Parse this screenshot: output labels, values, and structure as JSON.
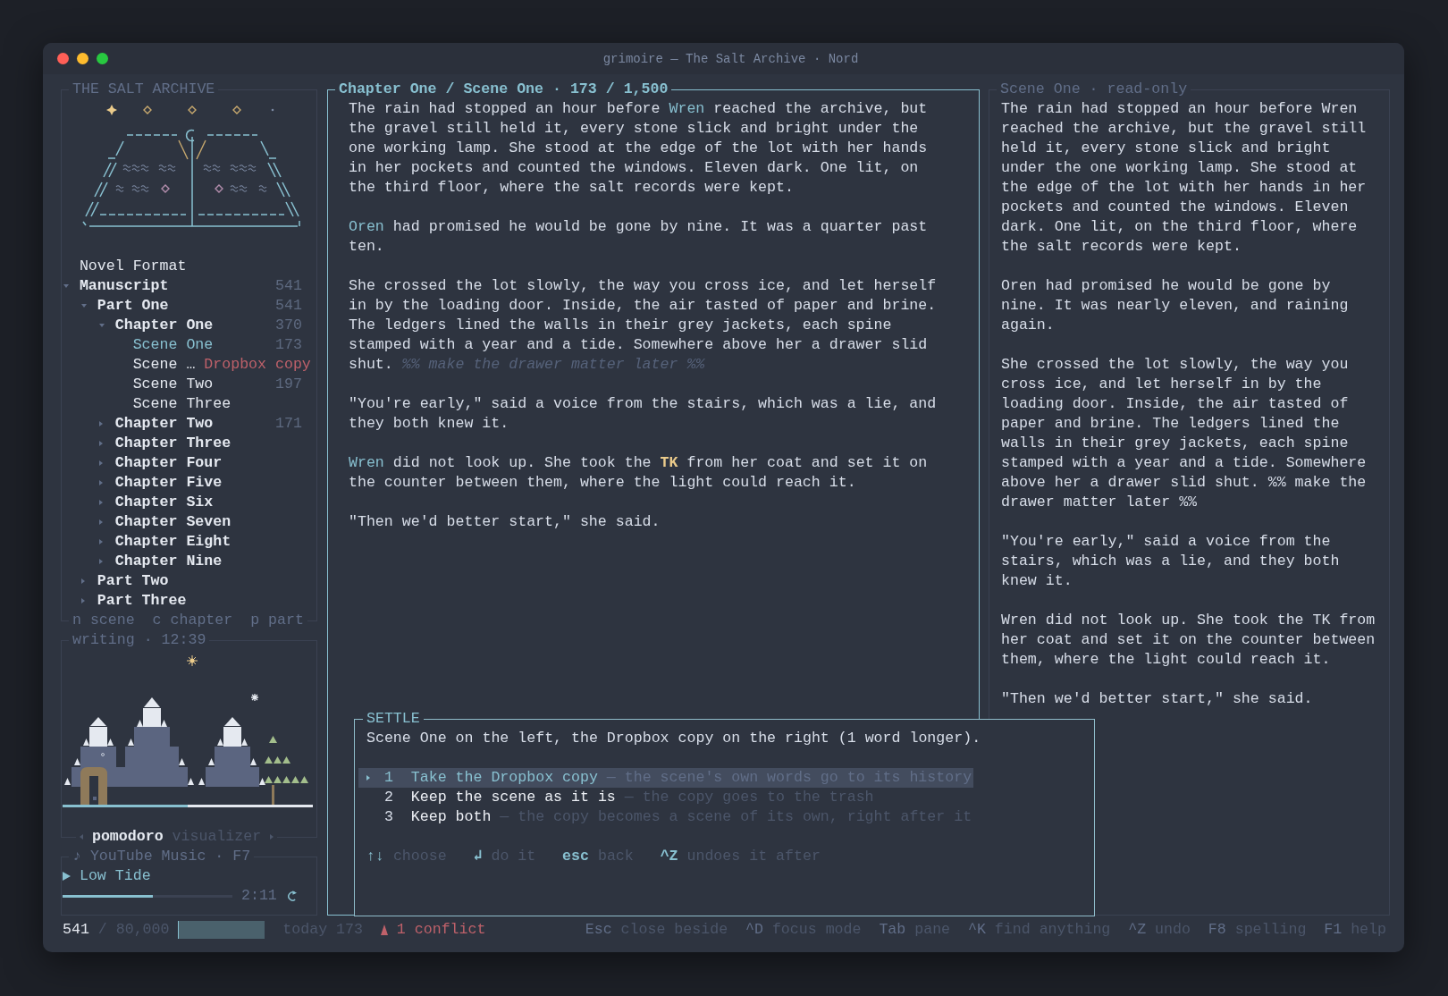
{
  "window": {
    "title": "grimoire — The Salt Archive · Nord"
  },
  "sidebar": {
    "title": "THE SALT ARCHIVE",
    "tree": [
      {
        "label": "Novel Format",
        "kind": "file",
        "selected": false
      },
      {
        "label": "Manuscript",
        "kind": "folder",
        "count": "541",
        "expanded": true,
        "selected": false,
        "children": [
          {
            "label": "Part One",
            "kind": "folder",
            "count": "541",
            "expanded": true,
            "selected": false,
            "children": [
              {
                "label": "Chapter One",
                "kind": "folder",
                "count": "370",
                "expanded": true,
                "selected": false,
                "children": [
                  {
                    "label": "Scene One",
                    "kind": "file",
                    "count": "173",
                    "selected": true
                  },
                  {
                    "label": "Scene …",
                    "kind": "file",
                    "tag": "Dropbox copy",
                    "selected": false
                  },
                  {
                    "label": "Scene Two",
                    "kind": "file",
                    "count": "197",
                    "selected": false
                  },
                  {
                    "label": "Scene Three",
                    "kind": "file",
                    "selected": false
                  }
                ]
              },
              {
                "label": "Chapter Two",
                "kind": "folder",
                "count": "171",
                "expanded": false,
                "selected": false
              },
              {
                "label": "Chapter Three",
                "kind": "folder",
                "expanded": false,
                "selected": false
              },
              {
                "label": "Chapter Four",
                "kind": "folder",
                "expanded": false,
                "selected": false
              },
              {
                "label": "Chapter Five",
                "kind": "folder",
                "expanded": false,
                "selected": false
              },
              {
                "label": "Chapter Six",
                "kind": "folder",
                "expanded": false,
                "selected": false
              },
              {
                "label": "Chapter Seven",
                "kind": "folder",
                "expanded": false,
                "selected": false
              },
              {
                "label": "Chapter Eight",
                "kind": "folder",
                "expanded": false,
                "selected": false
              },
              {
                "label": "Chapter Nine",
                "kind": "folder",
                "expanded": false,
                "selected": false
              }
            ]
          },
          {
            "label": "Part Two",
            "kind": "folder",
            "expanded": false,
            "selected": false
          },
          {
            "label": "Part Three",
            "kind": "folder",
            "expanded": false,
            "selected": false
          }
        ]
      }
    ],
    "hint": "n scene  c chapter  p part",
    "visualizer": {
      "title": "writing · 12:39",
      "level": 0.5,
      "tabs": [
        {
          "label": "pomodoro",
          "selected": true
        },
        {
          "label": "visualizer",
          "selected": false
        }
      ]
    },
    "music": {
      "title": "♪ YouTube Music · F7",
      "track": "Low Tide",
      "level": 0.53,
      "time": "2:11"
    }
  },
  "editor": {
    "title": "Chapter One / Scene One · 173 / 1,500",
    "paragraphs": [
      [
        {
          "kind": "text",
          "text": "The rain had stopped an hour before "
        },
        {
          "kind": "name",
          "text": "Wren"
        },
        {
          "kind": "text",
          "text": " reached the archive, but the gravel still held it, every stone slick and bright under the one working lamp. She stood at the edge of the lot with her hands in her pockets and counted the windows. Eleven dark. One lit, on the third floor, where the salt records were kept."
        }
      ],
      [
        {
          "kind": "name",
          "text": "Oren"
        },
        {
          "kind": "text",
          "text": " had promised he would be gone by nine. It was a quarter past ten."
        }
      ],
      [
        {
          "kind": "text",
          "text": "She crossed the lot slowly, the way you cross ice, and let herself in by the loading door. Inside, the air tasted of paper and brine. The ledgers lined the walls in their grey jackets, each spine stamped with a year and a tide. Somewhere above her a drawer slid shut. "
        },
        {
          "kind": "note",
          "text": "%% make the drawer matter later %%"
        }
      ],
      [
        {
          "kind": "text",
          "text": "\"You're early,\" said a voice from the stairs, which was a lie, and they both knew it."
        }
      ],
      [
        {
          "kind": "name",
          "text": "Wren"
        },
        {
          "kind": "text",
          "text": " did not look up. She took the "
        },
        {
          "kind": "mark",
          "text": "TK"
        },
        {
          "kind": "text",
          "text": " from her coat and set it on the counter between them, where the light could reach it."
        }
      ],
      [
        {
          "kind": "text",
          "text": "\"Then we'd better start,\" she said."
        }
      ]
    ]
  },
  "preview": {
    "title": "Scene One · read-only",
    "paragraphs": [
      "The rain had stopped an hour before Wren reached the archive, but the gravel still held it, every stone slick and bright under the one working lamp. She stood at the edge of the lot with her hands in her pockets and counted the windows. Eleven dark. One lit, on the third floor, where the salt records were kept.",
      "Oren had promised he would be gone by nine. It was nearly eleven, and raining again.",
      "She crossed the lot slowly, the way you cross ice, and let herself in by the loading door. Inside, the air tasted of paper and brine. The ledgers lined the walls in their grey jackets, each spine stamped with a year and a tide. Somewhere above her a drawer slid shut. %% make the drawer matter later %%",
      "\"You're early,\" said a voice from the stairs, which was a lie, and they both knew it.",
      "Wren did not look up. She took the TK from her coat and set it on the counter between them, where the light could reach it.",
      "\"Then we'd better start,\" she said."
    ]
  },
  "dialog": {
    "title": "SETTLE",
    "message": "Scene One on the left, the Dropbox copy on the right (1 word longer).",
    "options": [
      {
        "number": "1",
        "label": "Take the Dropbox copy",
        "detail": "— the scene's own words go to its history",
        "selected": true
      },
      {
        "number": "2",
        "label": "Keep the scene as it is",
        "detail": "— the copy goes to the trash",
        "selected": false
      },
      {
        "number": "3",
        "label": "Keep both",
        "detail": "— the copy becomes a scene of its own, right after it",
        "selected": false
      }
    ],
    "hints": [
      {
        "key": "↑↓",
        "label": "choose"
      },
      {
        "key": "↲",
        "label": "do it"
      },
      {
        "key": "esc",
        "label": "back"
      },
      {
        "key": "^Z",
        "label": "undoes it after"
      }
    ]
  },
  "status_bar": {
    "words": "541",
    "goal": "/ 80,000",
    "level": 0.007,
    "today": "today 173",
    "conflicts": "1 conflict",
    "hints": [
      {
        "key": "Esc",
        "label": "close beside"
      },
      {
        "key": "^D",
        "label": "focus mode"
      },
      {
        "key": "Tab",
        "label": "pane"
      },
      {
        "key": "^K",
        "label": "find anything"
      },
      {
        "key": "^Z",
        "label": "undo"
      },
      {
        "key": "F8",
        "label": "spelling"
      },
      {
        "key": "F1",
        "label": "help"
      }
    ]
  }
}
